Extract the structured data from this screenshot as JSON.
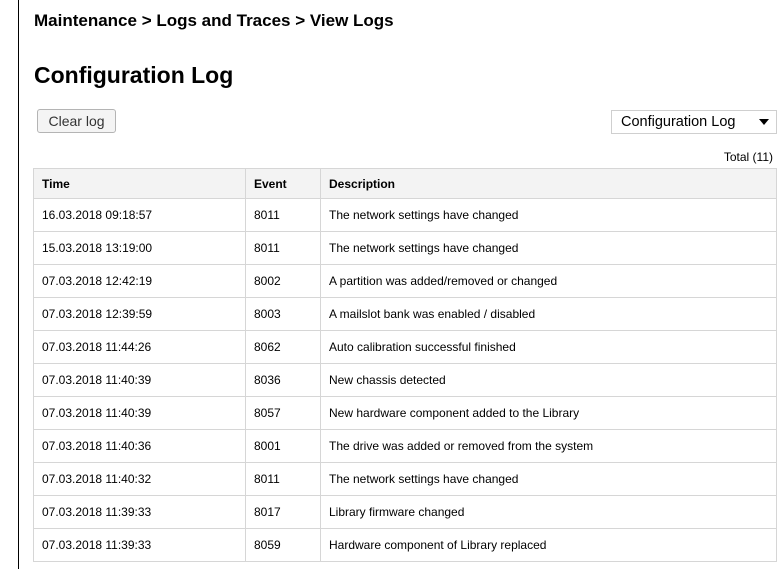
{
  "breadcrumb": "Maintenance > Logs and Traces > View Logs",
  "page_title": "Configuration Log",
  "clear_button": "Clear log",
  "log_select": {
    "selected": "Configuration Log"
  },
  "total": "Total (11)",
  "table": {
    "headers": {
      "time": "Time",
      "event": "Event",
      "description": "Description"
    },
    "rows": [
      {
        "time": "16.03.2018 09:18:57",
        "event": "8011",
        "description": "The network settings have changed"
      },
      {
        "time": "15.03.2018 13:19:00",
        "event": "8011",
        "description": "The network settings have changed"
      },
      {
        "time": "07.03.2018 12:42:19",
        "event": "8002",
        "description": "A partition was added/removed or changed"
      },
      {
        "time": "07.03.2018 12:39:59",
        "event": "8003",
        "description": "A mailslot bank was enabled / disabled"
      },
      {
        "time": "07.03.2018 11:44:26",
        "event": "8062",
        "description": "Auto calibration successful finished"
      },
      {
        "time": "07.03.2018 11:40:39",
        "event": "8036",
        "description": "New chassis detected"
      },
      {
        "time": "07.03.2018 11:40:39",
        "event": "8057",
        "description": "New hardware component added to the Library"
      },
      {
        "time": "07.03.2018 11:40:36",
        "event": "8001",
        "description": "The drive was added or removed from the system"
      },
      {
        "time": "07.03.2018 11:40:32",
        "event": "8011",
        "description": "The network settings have changed"
      },
      {
        "time": "07.03.2018 11:39:33",
        "event": "8017",
        "description": "Library firmware changed"
      },
      {
        "time": "07.03.2018 11:39:33",
        "event": "8059",
        "description": "Hardware component of Library replaced"
      }
    ]
  }
}
